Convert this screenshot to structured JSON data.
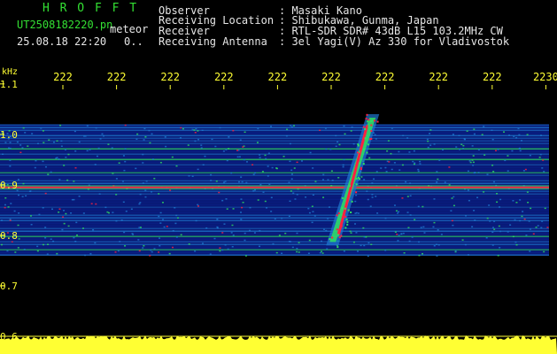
{
  "header": {
    "app_name": "H R O F F T",
    "filename": "UT2508182220.pn",
    "mode": "meteor",
    "datetime": "25.08.18 22:20",
    "counter": "0..",
    "info_labels": [
      "Observer",
      "Receiving Location",
      "Receiver",
      "Receiving Antenna"
    ],
    "info_values": [
      ": Masaki Kano",
      ": Shibukawa, Gunma, Japan",
      ": RTL-SDR SDR# 43dB L15 103.2MHz CW",
      ": 3el Yagi(V) Az 330 for Vladivostok"
    ]
  },
  "colors": {
    "background": "#000000",
    "title": "#33e033",
    "text": "#e6e6e6",
    "axis": "#ffff33",
    "noise_low": "#0a1f8a",
    "noise_mid": "#1e78d0",
    "signal_high": "#30e060",
    "signal_peak": "#ff2040",
    "level_bar": "#ffff33"
  },
  "chart_data": {
    "type": "heatmap",
    "xlabel": "",
    "ylabel": "kHz",
    "x_tick_labels": [
      "222",
      "222",
      "222",
      "222",
      "222",
      "222",
      "222",
      "222",
      "222",
      "2230"
    ],
    "y_tick_labels": [
      "1.1",
      "1.0",
      "0.9",
      "0.8",
      "0.7",
      "0.6"
    ],
    "y_ticks": [
      1.1,
      1.0,
      0.9,
      0.8,
      0.7,
      0.6
    ],
    "ylim": [
      0.6,
      1.14
    ],
    "noise_band_khz": [
      0.76,
      1.02
    ],
    "carrier_khz": 0.895,
    "meteor_echo": {
      "x_tick_position": 5.4,
      "freq_range_khz": [
        0.78,
        1.04
      ]
    },
    "grid": false
  }
}
